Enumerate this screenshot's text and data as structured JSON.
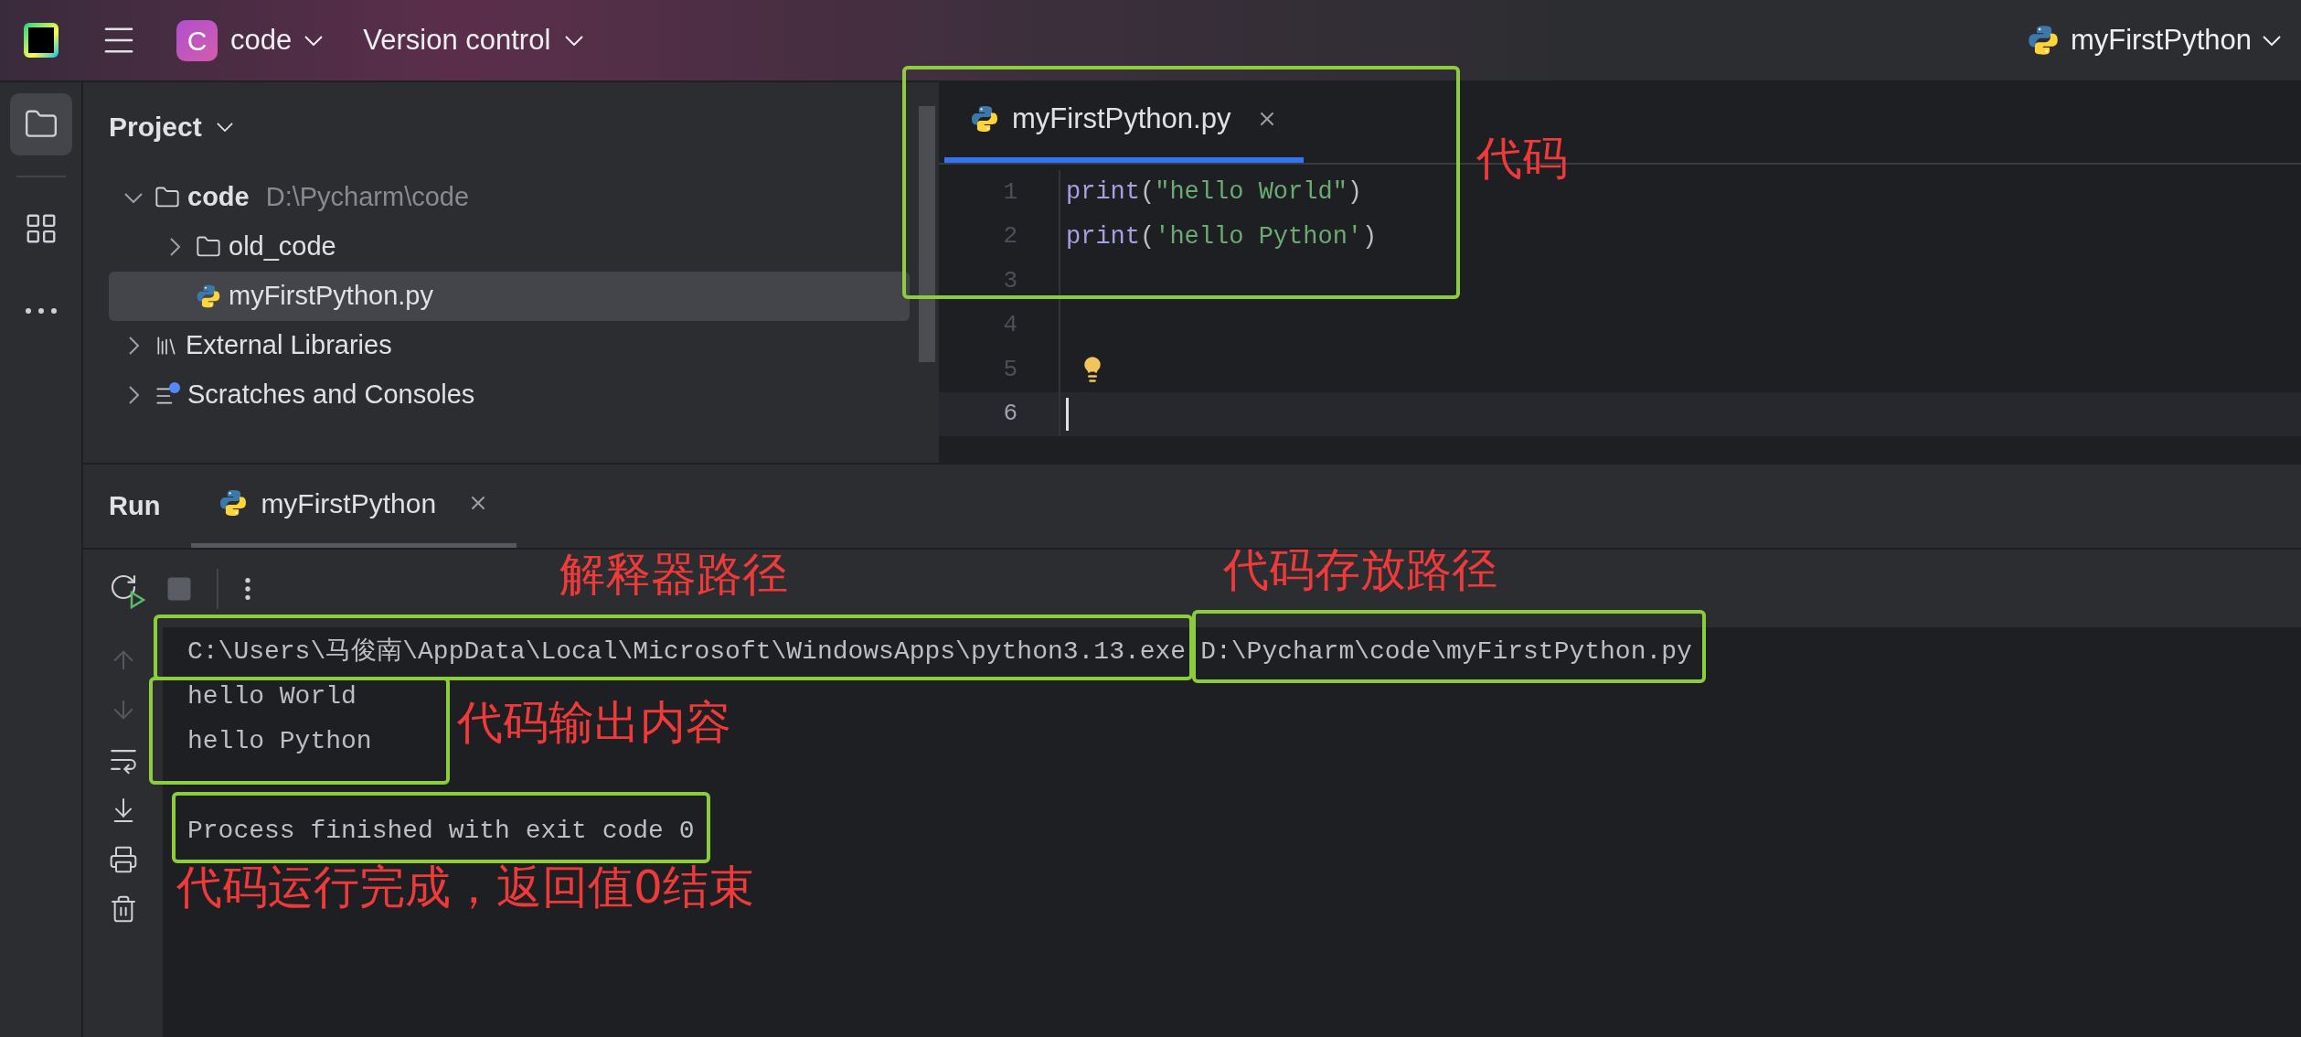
{
  "title_bar": {
    "project_initial": "C",
    "project": "code",
    "vcs": "Version control",
    "run_config": "myFirstPython"
  },
  "tool_strip": [
    {
      "kind": "project",
      "selected": true
    },
    {
      "kind": "structure",
      "selected": false
    },
    {
      "kind": "more",
      "selected": false
    }
  ],
  "project_panel": {
    "title": "Project",
    "tree": [
      {
        "name": "code",
        "path": "D:\\Pycharm\\code",
        "kind": "folder",
        "expanded": true,
        "selected": false,
        "children": [
          {
            "name": "old_code",
            "kind": "folder",
            "expanded": false,
            "selected": false
          },
          {
            "name": "myFirstPython.py",
            "kind": "python",
            "selected": true
          }
        ]
      },
      {
        "name": "External Libraries",
        "kind": "library",
        "expanded": false,
        "selected": false
      },
      {
        "name": "Scratches and Consoles",
        "kind": "scratches",
        "expanded": false,
        "selected": false
      }
    ]
  },
  "editor": {
    "tabs": [
      {
        "label": "myFirstPython.py",
        "selected": true
      }
    ],
    "lines": [
      {
        "number": "1",
        "current": false,
        "bulb": false,
        "tokens": [
          {
            "kind": "builtin",
            "text": "print"
          },
          {
            "kind": "paren",
            "text": "("
          },
          {
            "kind": "string",
            "text": "\"hello World\""
          },
          {
            "kind": "paren",
            "text": ")"
          }
        ]
      },
      {
        "number": "2",
        "current": false,
        "bulb": false,
        "tokens": [
          {
            "kind": "builtin",
            "text": "print"
          },
          {
            "kind": "paren",
            "text": "("
          },
          {
            "kind": "string",
            "text": "'hello Python'"
          },
          {
            "kind": "paren",
            "text": ")"
          }
        ]
      },
      {
        "number": "3",
        "current": false,
        "bulb": false
      },
      {
        "number": "4",
        "current": false,
        "bulb": false
      },
      {
        "number": "5",
        "current": false,
        "bulb": true
      },
      {
        "number": "6",
        "current": true,
        "bulb": false
      }
    ]
  },
  "run_panel": {
    "title": "Run",
    "tabs": [
      {
        "label": "myFirstPython",
        "selected": true
      }
    ],
    "console": [
      {
        "kind": "command",
        "interpreter": "C:\\Users\\马俊南\\AppData\\Local\\Microsoft\\WindowsApps\\python3.13.exe",
        "script": "D:\\Pycharm\\code\\myFirstPython.py"
      },
      {
        "kind": "output",
        "text": "hello World"
      },
      {
        "kind": "output",
        "text": "hello Python"
      },
      {
        "kind": "status",
        "text": "Process finished with exit code 0"
      }
    ]
  },
  "annotations": [
    {
      "text": "代码"
    },
    {
      "text": "解释器路径"
    },
    {
      "text": "代码存放路径"
    },
    {
      "text": "代码输出内容"
    },
    {
      "text": "代码运行完成，返回值0结束"
    }
  ]
}
